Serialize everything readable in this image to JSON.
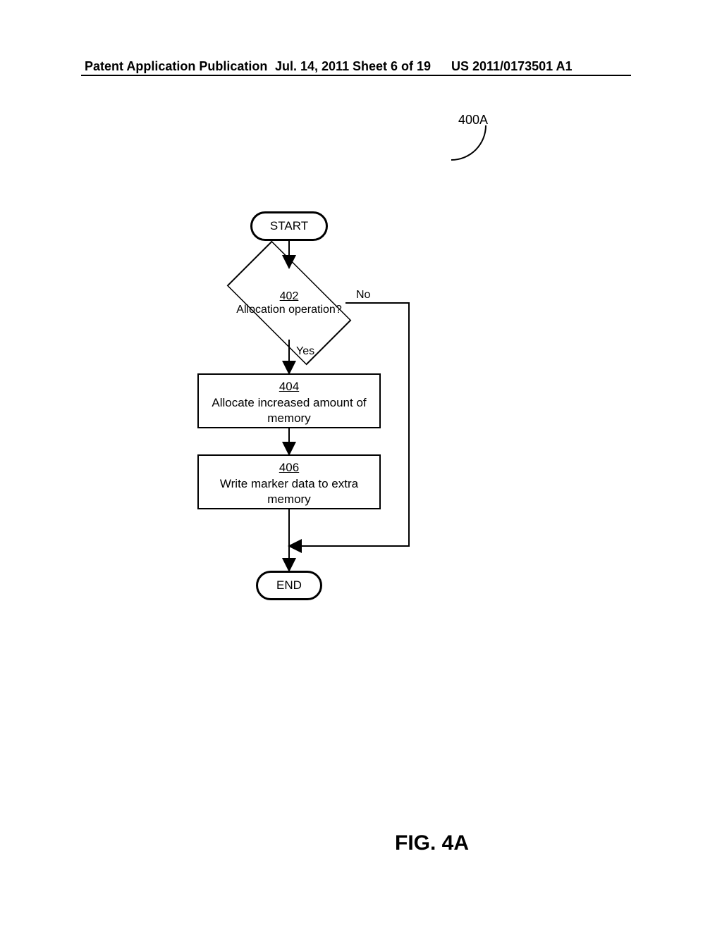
{
  "header": {
    "left": "Patent Application Publication",
    "date": "Jul. 14, 2011",
    "sheet": "Sheet 6 of 19",
    "pubnum": "US 2011/0173501 A1"
  },
  "figure": {
    "ref": "400A",
    "label": "FIG. 4A"
  },
  "flow": {
    "start": "START",
    "end": "END",
    "decision": {
      "ref": "402",
      "text": "Allocation operation?",
      "yes": "Yes",
      "no": "No"
    },
    "step404": {
      "ref": "404",
      "text": "Allocate increased amount of memory"
    },
    "step406": {
      "ref": "406",
      "text": "Write marker data to extra memory"
    }
  }
}
